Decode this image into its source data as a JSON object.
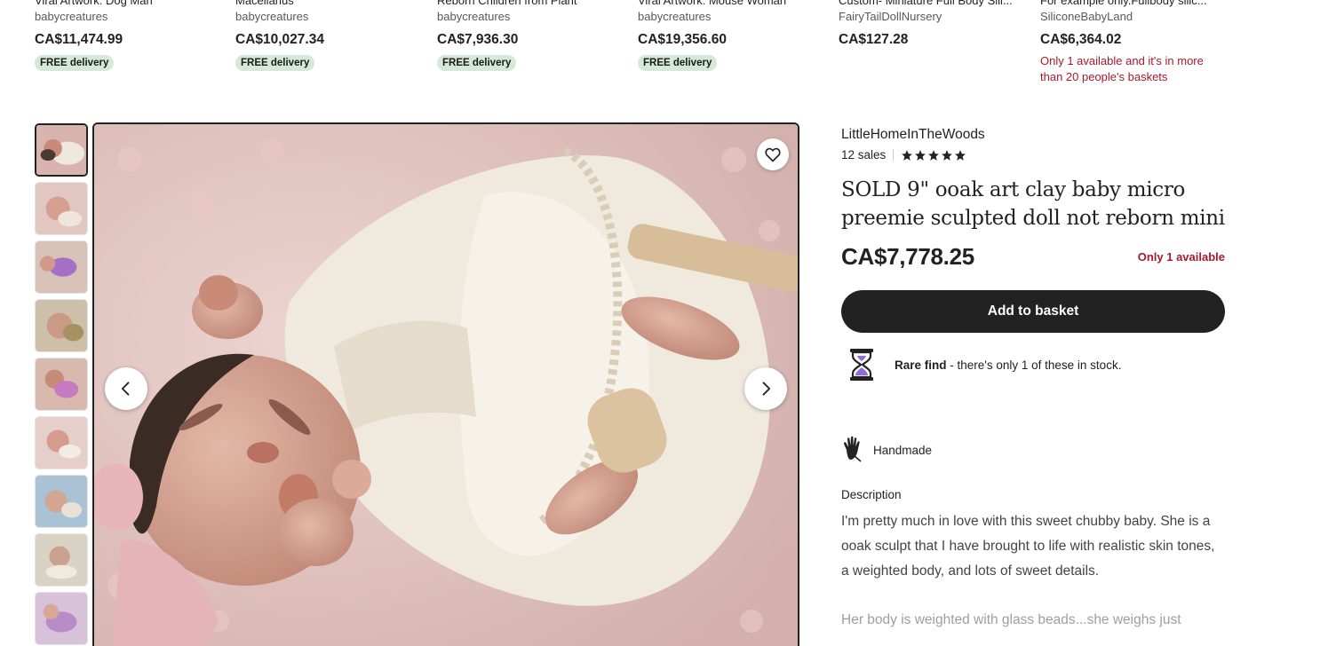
{
  "related": [
    {
      "title": "Viral Artwork: Dog Man",
      "shop": "babycreatures",
      "price": "CA$11,474.99",
      "badge": "FREE delivery",
      "note": ""
    },
    {
      "title": "Macellarius",
      "shop": "babycreatures",
      "price": "CA$10,027.34",
      "badge": "FREE delivery",
      "note": ""
    },
    {
      "title": "Reborn Children from Plant",
      "shop": "babycreatures",
      "price": "CA$7,936.30",
      "badge": "FREE delivery",
      "note": ""
    },
    {
      "title": "Viral Artwork: Mouse Woman",
      "shop": "babycreatures",
      "price": "CA$19,356.60",
      "badge": "FREE delivery",
      "note": ""
    },
    {
      "title": "Custom- Miniature Full Body Sili...",
      "shop": "FairyTailDollNursery",
      "price": "CA$127.28",
      "badge": "",
      "note": ""
    },
    {
      "title": "For example only.Fullbody silic...",
      "shop": "SiliconeBabyLand",
      "price": "CA$6,364.02",
      "badge": "",
      "note": "Only 1 available and it's in more than 20 people's baskets"
    }
  ],
  "gallery": {
    "thumb_count": 9,
    "active_index": 0,
    "favorite_icon": "heart-outline-icon",
    "prev_icon": "chevron-left-icon",
    "next_icon": "chevron-right-icon"
  },
  "listing": {
    "shop_name": "LittleHomeInTheWoods",
    "sales": "12 sales",
    "rating": 5,
    "title": "SOLD 9\" ooak art clay baby micro preemie sculpted doll not reborn mini",
    "price": "CA$7,778.25",
    "availability": "Only 1 available",
    "add_to_basket": "Add to basket",
    "rare_bold": "Rare find",
    "rare_rest": " - there's only 1 of these in stock.",
    "handmade": "Handmade",
    "description_heading": "Description",
    "description": "I'm pretty much in love with this sweet chubby baby. She is a ooak sculpt that I have brought to life with realistic skin tones, a weighted body, and lots of sweet details.",
    "description_more": "Her body is weighted with glass beads...she weighs just"
  },
  "colors": {
    "primary_button": "#222222",
    "alert_red": "#a61a2e",
    "free_badge": "#d4e9d7"
  }
}
